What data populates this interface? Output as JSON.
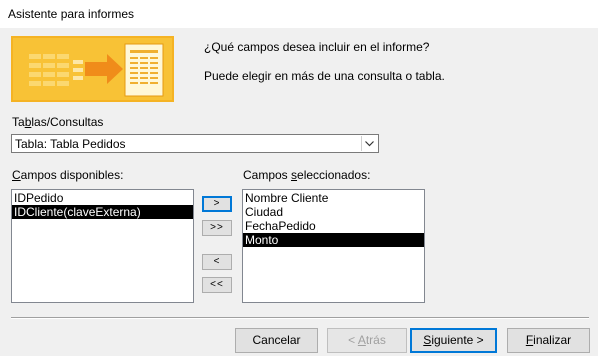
{
  "window": {
    "title": "Asistente para informes"
  },
  "intro": {
    "question": "¿Qué campos desea incluir en el informe?",
    "hint": "Puede elegir en más de una consulta o tabla."
  },
  "tables": {
    "label_pre": "Ta",
    "label_access": "b",
    "label_post": "las/Consultas",
    "selected": "Tabla: Tabla Pedidos"
  },
  "available": {
    "label_access": "C",
    "label_post": "ampos disponibles:",
    "items": [
      {
        "text": "IDPedido",
        "selected": false
      },
      {
        "text": "IDCliente(claveExterna)",
        "selected": true
      }
    ]
  },
  "selected_fields": {
    "label_pre": "Campos ",
    "label_access": "s",
    "label_post": "eleccionados:",
    "items": [
      {
        "text": "Nombre Cliente",
        "selected": false
      },
      {
        "text": "Ciudad",
        "selected": false
      },
      {
        "text": "FechaPedido",
        "selected": false
      },
      {
        "text": "Monto",
        "selected": true
      }
    ]
  },
  "move_buttons": {
    "add_one": ">",
    "add_all": ">>",
    "remove_one": "<",
    "remove_all": "<<"
  },
  "footer": {
    "cancel": "Cancelar",
    "back_pre": "< ",
    "back_access": "A",
    "back_post": "trás",
    "next_pre": "",
    "next_access": "S",
    "next_post": "iguiente >",
    "finish_pre": "",
    "finish_access": "F",
    "finish_post": "inalizar"
  },
  "colors": {
    "accent": "#0078d7",
    "selection": "#000000",
    "art_orange": "#f5a623",
    "art_yellow": "#fbd34c"
  }
}
